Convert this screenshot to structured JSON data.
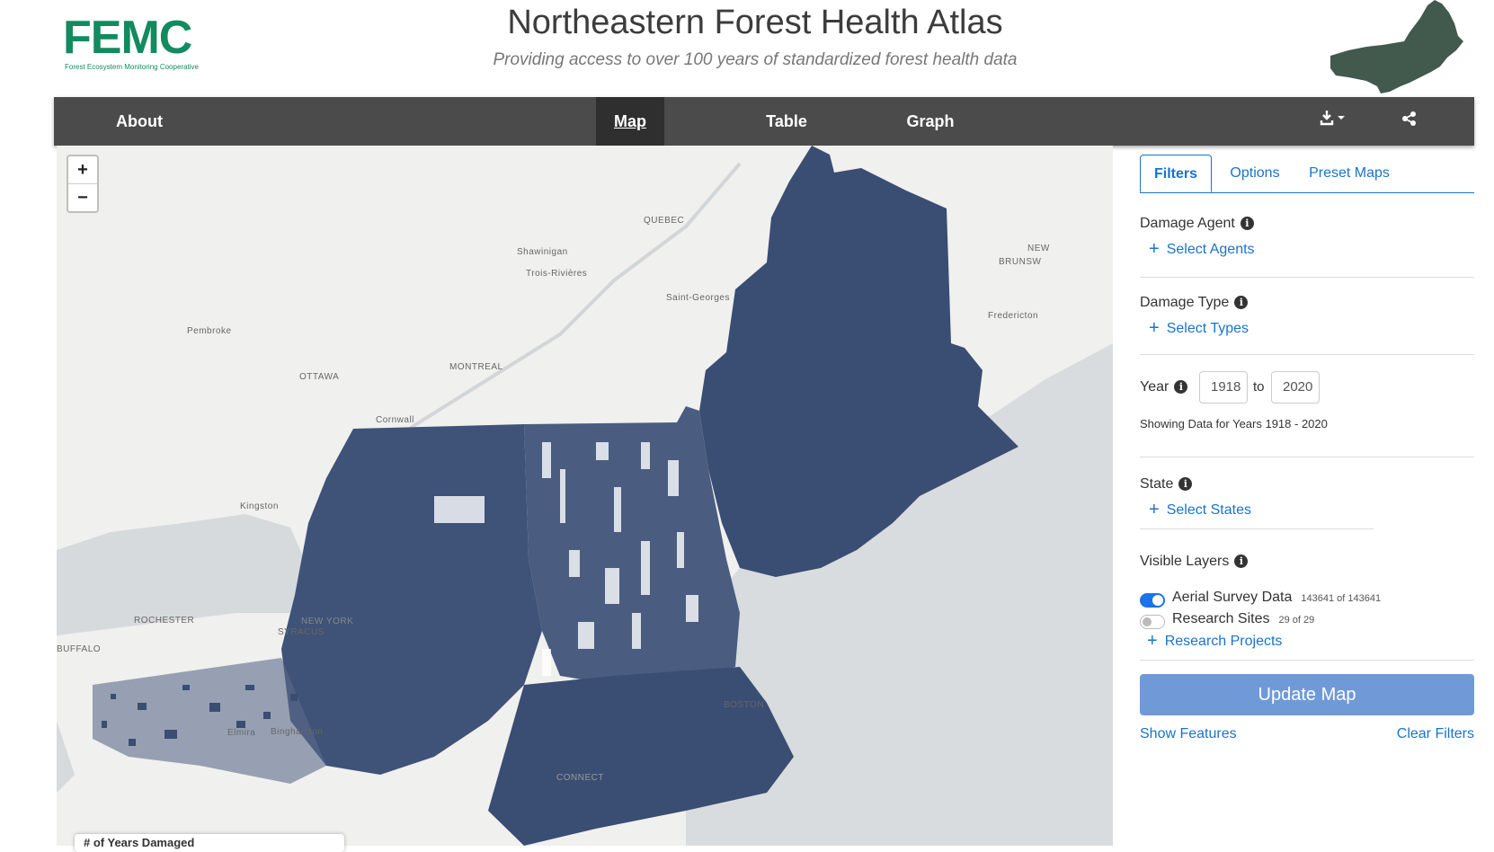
{
  "header": {
    "logo_text": "FEMC",
    "logo_subtitle": "Forest Ecosystem Monitoring Cooperative",
    "title": "Northeastern Forest Health Atlas",
    "subtitle": "Providing access to over 100 years of standardized forest health data"
  },
  "nav": {
    "about": "About",
    "map": "Map",
    "table": "Table",
    "graph": "Graph",
    "download_icon": "download-icon",
    "share_icon": "share-icon"
  },
  "map": {
    "zoom_in": "+",
    "zoom_out": "−",
    "labels": {
      "quebec": "QUEBEC",
      "shawinigan": "Shawinigan",
      "trois_rivieres": "Trois-Rivières",
      "saint_georges": "Saint-Georges",
      "new_brunswick_1": "NEW",
      "new_brunswick_2": "BRUNSW",
      "fredericton": "Fredericton",
      "pembroke": "Pembroke",
      "ottawa": "OTTAWA",
      "montreal": "MONTREAL",
      "cornwall": "Cornwall",
      "kingston": "Kingston",
      "rochester": "ROCHESTER",
      "buffalo": "BUFFALO",
      "syracuse": "SYRACUS",
      "new_york": "NEW YORK",
      "boston": "BOSTON",
      "binghamton": "Binghamton",
      "elmira": "Elmira",
      "connecticut": "CONNECT"
    },
    "legend_stub": "# of Years Damaged"
  },
  "sidebar": {
    "tabs": [
      "Filters",
      "Options",
      "Preset Maps"
    ],
    "damage_agent_label": "Damage Agent",
    "select_agents": "Select Agents",
    "damage_type_label": "Damage Type",
    "select_types": "Select Types",
    "year_label": "Year",
    "year_from": "1918",
    "year_to_word": "to",
    "year_to": "2020",
    "showing_years": "Showing Data for Years 1918 - 2020",
    "state_label": "State",
    "select_states": "Select States",
    "visible_layers_label": "Visible Layers",
    "layers": [
      {
        "name": "Aerial Survey Data",
        "count": "143641 of 143641",
        "enabled": true
      },
      {
        "name": "Research Sites",
        "count": "29 of 29",
        "enabled": false
      }
    ],
    "research_projects": "Research Projects",
    "update_button": "Update Map",
    "show_features": "Show Features",
    "clear_filters": "Clear Filters"
  },
  "colors": {
    "nav_bg": "#4b4b4b",
    "accent_blue": "#1a73c9",
    "update_btn": "#6f9ad7",
    "damage_fill": "#3a4d72",
    "logo_green": "#138a5f"
  }
}
